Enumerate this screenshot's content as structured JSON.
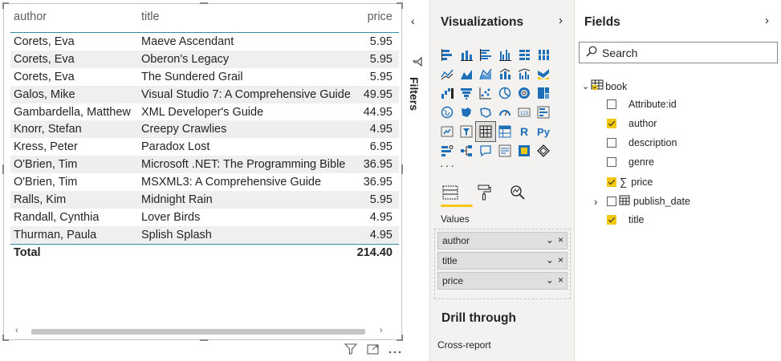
{
  "table": {
    "columns": [
      "author",
      "title",
      "price"
    ],
    "rows": [
      [
        "Corets, Eva",
        "Maeve Ascendant",
        "5.95"
      ],
      [
        "Corets, Eva",
        "Oberon's Legacy",
        "5.95"
      ],
      [
        "Corets, Eva",
        "The Sundered Grail",
        "5.95"
      ],
      [
        "Galos, Mike",
        "Visual Studio 7: A Comprehensive Guide",
        "49.95"
      ],
      [
        "Gambardella, Matthew",
        "XML Developer's Guide",
        "44.95"
      ],
      [
        "Knorr, Stefan",
        "Creepy Crawlies",
        "4.95"
      ],
      [
        "Kress, Peter",
        "Paradox Lost",
        "6.95"
      ],
      [
        "O'Brien, Tim",
        "Microsoft .NET: The Programming Bible",
        "36.95"
      ],
      [
        "O'Brien, Tim",
        "MSXML3: A Comprehensive Guide",
        "36.95"
      ],
      [
        "Ralls, Kim",
        "Midnight Rain",
        "5.95"
      ],
      [
        "Randall, Cynthia",
        "Lover Birds",
        "4.95"
      ],
      [
        "Thurman, Paula",
        "Splish Splash",
        "4.95"
      ]
    ],
    "total_label": "Total",
    "total_value": "214.40",
    "accent_color": "#2f8fa3"
  },
  "filters": {
    "label": "Filters"
  },
  "visualizations": {
    "title": "Visualizations",
    "more": "···",
    "values_label": "Values",
    "wells": [
      "author",
      "title",
      "price"
    ],
    "drill_title": "Drill through",
    "cross_report": "Cross-report",
    "r_label": "R",
    "py_label": "Py",
    "accent": "#f2c811"
  },
  "fields": {
    "title": "Fields",
    "search_placeholder": "Search",
    "table_name": "book",
    "items": [
      {
        "name": "Attribute:id",
        "checked": false
      },
      {
        "name": "author",
        "checked": true
      },
      {
        "name": "description",
        "checked": false
      },
      {
        "name": "genre",
        "checked": false
      },
      {
        "name": "price",
        "checked": true
      },
      {
        "name": "publish_date",
        "checked": false
      },
      {
        "name": "title",
        "checked": true
      }
    ]
  }
}
